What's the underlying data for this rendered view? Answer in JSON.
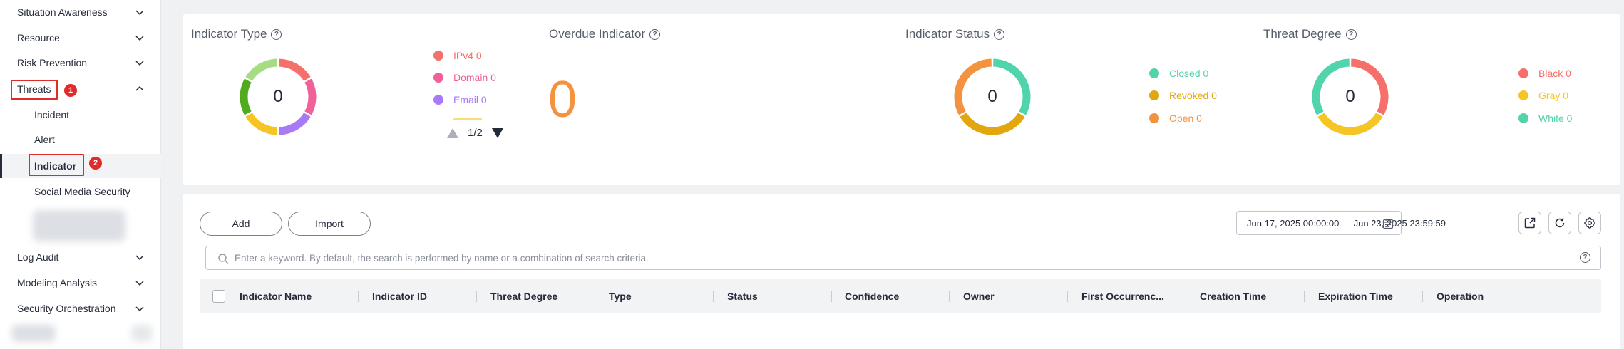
{
  "sidebar": {
    "items": [
      {
        "label": "Situation Awareness",
        "expanded": false
      },
      {
        "label": "Resource",
        "expanded": false
      },
      {
        "label": "Risk Prevention",
        "expanded": false
      },
      {
        "label": "Threats",
        "expanded": true
      },
      {
        "label": "Log Audit",
        "expanded": false
      },
      {
        "label": "Modeling Analysis",
        "expanded": false
      },
      {
        "label": "Security Orchestration",
        "expanded": false
      }
    ],
    "threats_children": [
      {
        "label": "Incident"
      },
      {
        "label": "Alert"
      },
      {
        "label": "Indicator",
        "active": true
      },
      {
        "label": "Social Media Security"
      }
    ],
    "callouts": [
      "1",
      "2"
    ]
  },
  "stats": {
    "indicator_type": {
      "title": "Indicator Type",
      "total": "0",
      "legend": [
        {
          "label": "IPv4 0",
          "color": "#f66f6a"
        },
        {
          "label": "Domain 0",
          "color": "#f0609b"
        },
        {
          "label": "Email 0",
          "color": "#a97af8"
        }
      ],
      "pager": "1/2",
      "segment_colors": [
        "#f66f6a",
        "#f0609b",
        "#a97af8",
        "#f5c623",
        "#50ab1e",
        "#a6dd82"
      ]
    },
    "overdue_indicator": {
      "title": "Overdue Indicator",
      "value": "0",
      "color": "#f5923e"
    },
    "indicator_status": {
      "title": "Indicator Status",
      "total": "0",
      "legend": [
        {
          "label": "Closed 0",
          "color": "#50d4ab"
        },
        {
          "label": "Revoked 0",
          "color": "#e2a70f"
        },
        {
          "label": "Open 0",
          "color": "#f5923e"
        }
      ]
    },
    "threat_degree": {
      "title": "Threat Degree",
      "total": "0",
      "legend": [
        {
          "label": "Black 0",
          "color": "#f66f6a"
        },
        {
          "label": "Gray 0",
          "color": "#f5c623"
        },
        {
          "label": "White 0",
          "color": "#50d4ab"
        }
      ]
    }
  },
  "toolbar": {
    "add_label": "Add",
    "import_label": "Import",
    "date_range": "Jun 17, 2025 00:00:00 — Jun 23, 2025 23:59:59",
    "search_placeholder": "Enter a keyword. By default, the search is performed by name or a combination of search criteria."
  },
  "table": {
    "columns": [
      "Indicator Name",
      "Indicator ID",
      "Threat Degree",
      "Type",
      "Status",
      "Confidence",
      "Owner",
      "First Occurrenc...",
      "Creation Time",
      "Expiration Time",
      "Operation"
    ]
  }
}
